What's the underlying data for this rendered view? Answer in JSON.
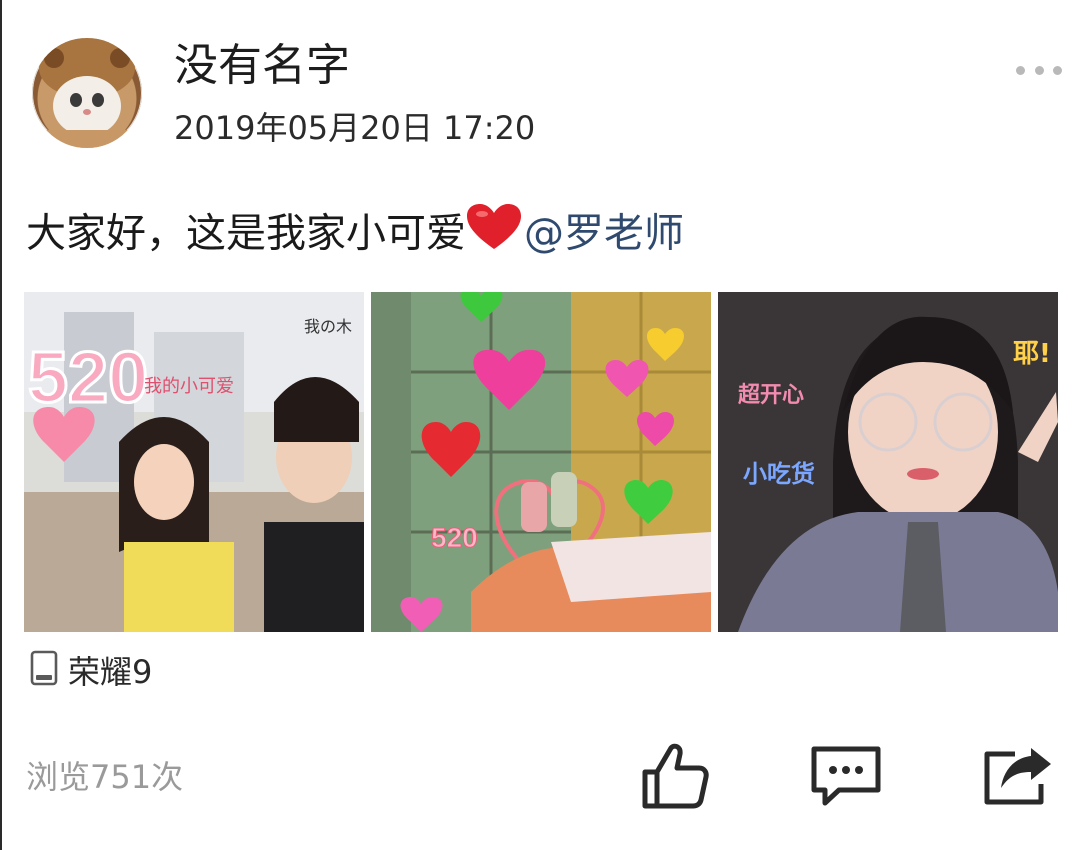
{
  "post": {
    "username": "没有名字",
    "timestamp": "2019年05月20日 17:20",
    "text_before": "大家好，这是我家小可爱",
    "emoji": "red-heart",
    "mention": "@罗老师",
    "device_icon": "phone-icon",
    "device": "荣耀9",
    "views": "浏览751次"
  },
  "photos": [
    {
      "name": "couple-selfie",
      "stickers": [
        "520",
        "我的小可爱",
        "我の木"
      ]
    },
    {
      "name": "shoes-hearts",
      "stickers": [
        "520"
      ]
    },
    {
      "name": "girl-portrait",
      "stickers": [
        "超开心",
        "小吃货",
        "耶!"
      ]
    }
  ],
  "actions": [
    {
      "name": "like",
      "icon": "thumbs-up-icon"
    },
    {
      "name": "comment",
      "icon": "comment-icon"
    },
    {
      "name": "share",
      "icon": "share-icon"
    }
  ],
  "colors": {
    "mention": "#2f4a6e",
    "secondary_text": "#9a9a9a",
    "icon": "#2a2a2a",
    "more_dots": "#b9b9b9"
  }
}
